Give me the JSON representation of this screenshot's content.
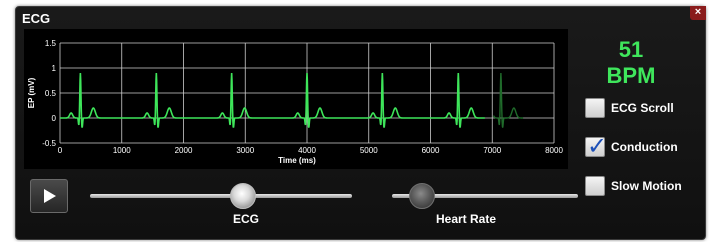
{
  "window": {
    "title": "ECG",
    "close_label": "×"
  },
  "chart_data": {
    "type": "line",
    "xlabel": "Time (ms)",
    "ylabel": "EP (mV)",
    "xlim": [
      0,
      8000
    ],
    "ylim": [
      -0.5,
      1.5
    ],
    "x_ticks": [
      "0",
      "1000",
      "2000",
      "3000",
      "4000",
      "5000",
      "6000",
      "7000",
      "8000"
    ],
    "y_ticks": [
      "1.5",
      "1",
      "0.5",
      "0",
      "-0.5"
    ],
    "grid": true,
    "line_color": "#3ee55a",
    "faded_line_color": "#1f6a2a",
    "beat_times_ms": [
      330,
      1560,
      2780,
      4000,
      5220,
      6450
    ],
    "faded_beat_times_ms": [
      7140
    ],
    "beat_shape": {
      "p_wave_offset_ms": -150,
      "p_wave_amp": 0.1,
      "q_amp": -0.15,
      "r_amp": 0.9,
      "s_amp": -0.2,
      "t_wave_offset_ms": 210,
      "t_wave_amp": 0.2
    }
  },
  "status": {
    "bpm_value": "51",
    "bpm_unit": "BPM"
  },
  "options": [
    {
      "label": "ECG Scroll",
      "checked": false
    },
    {
      "label": "Conduction",
      "checked": true
    },
    {
      "label": "Slow Motion",
      "checked": false
    }
  ],
  "controls": {
    "ecg_slider": {
      "label": "ECG",
      "value": 0.58
    },
    "heart_rate_slider": {
      "label": "Heart Rate",
      "value": 0.17
    }
  },
  "icons": {
    "play": "play-icon",
    "close": "close-icon",
    "check": "checkmark-icon"
  }
}
